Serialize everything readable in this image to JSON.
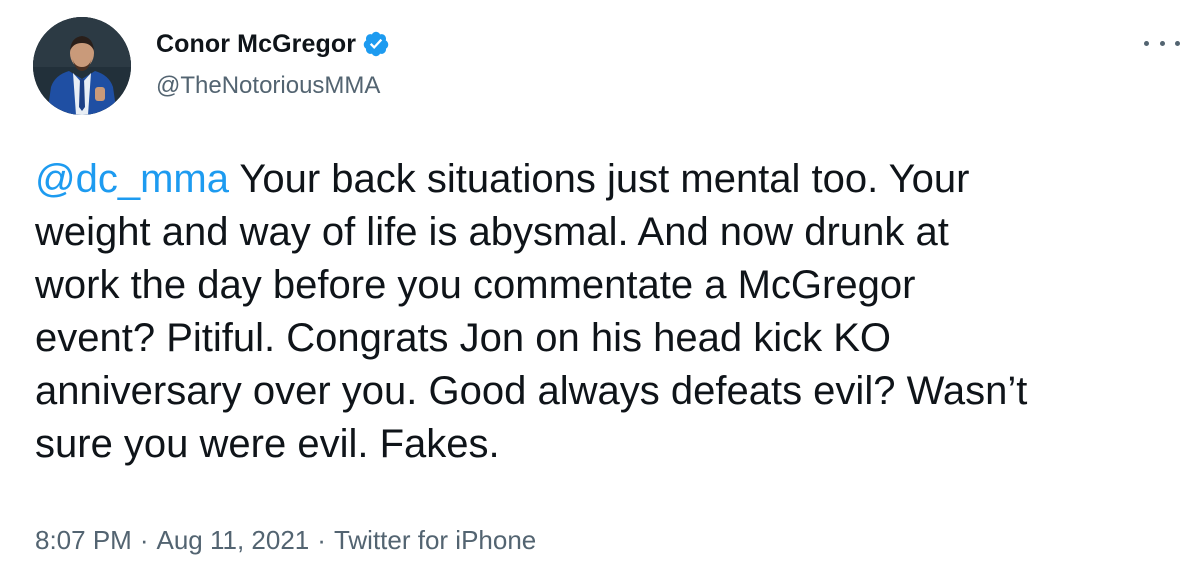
{
  "author": {
    "name": "Conor McGregor",
    "handle": "@TheNotoriousMMA",
    "verified": true,
    "verified_color": "#1d9bf0",
    "avatar_icon": "profile-photo-man-in-blue-suit"
  },
  "menu": {
    "more_icon": "more-horizontal-icon"
  },
  "tweet": {
    "mention": "@dc_mma",
    "text": " Your back situations just mental too. Your weight and way of life is abysmal. And now drunk at work the day before you commentate a McGregor event? Pitiful. Congrats Jon on his head kick KO anniversary over you. Good always defeats evil? Wasn’t sure you were evil. Fakes.",
    "lines": [
      " Your back situations just mental too. Your",
      "weight and way of life is abysmal. And now drunk at",
      "work the day before you commentate a McGregor",
      "event? Pitiful. Congrats Jon on his head kick KO",
      "anniversary over you. Good always defeats evil? Wasn’t",
      "sure you were evil. Fakes."
    ]
  },
  "meta": {
    "time": "8:07 PM",
    "date": "Aug 11, 2021",
    "source": "Twitter for iPhone",
    "separator": "·"
  },
  "colors": {
    "text": "#0f1419",
    "secondary": "#536471",
    "link": "#1d9bf0"
  }
}
